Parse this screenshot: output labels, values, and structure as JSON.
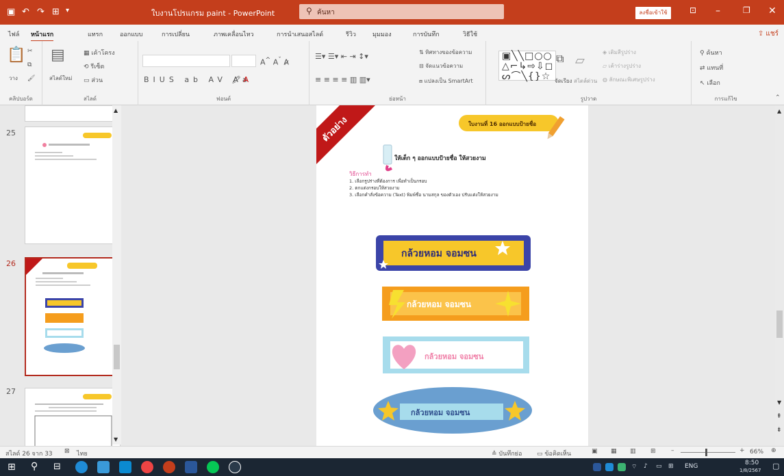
{
  "window": {
    "title": "ใบงานโปรแกรม paint - PowerPoint",
    "search_placeholder": "ค้นหา",
    "signin_label": "ลงชื่อเข้าใช้"
  },
  "tabs": [
    {
      "label": "ไฟล์"
    },
    {
      "label": "หน้าแรก"
    },
    {
      "label": "แทรก"
    },
    {
      "label": "ออกแบบ"
    },
    {
      "label": "การเปลี่ยน"
    },
    {
      "label": "ภาพเคลื่อนไหว"
    },
    {
      "label": "การนำเสนอสไลด์"
    },
    {
      "label": "รีวิว"
    },
    {
      "label": "มุมมอง"
    },
    {
      "label": "การบันทึก"
    },
    {
      "label": "วิธีใช้"
    }
  ],
  "share_label": "แชร์",
  "ribbon": {
    "groups": [
      "คลิปบอร์ด",
      "สไลด์",
      "ฟอนต์",
      "ย่อหน้า",
      "รูปวาด",
      "การแก้ไข"
    ],
    "paste_label": "วาง",
    "new_slide_label": "สไลด์ใหม่",
    "layout_label": "เค้าโครง",
    "reset_label": "รีเซ็ต",
    "section_label": "ส่วน",
    "text_direction_label": "ทิศทางของข้อความ",
    "align_text_label": "จัดแนวข้อความ",
    "smartart_label": "แปลงเป็น SmartArt",
    "arrange_label": "จัดเรียง",
    "quick_styles_label": "สไตล์ด่วน",
    "fill_label": "เติมสีรูปร่าง",
    "outline_label": "เค้าร่างรูปร่าง",
    "effects_label": "ลักษณะพิเศษรูปร่าง",
    "find_label": "ค้นหา",
    "replace_label": "แทนที่",
    "select_label": "เลือก"
  },
  "slides_panel": {
    "numbers": [
      "25",
      "26",
      "27"
    ]
  },
  "slide": {
    "ribbon_label": "ตัวอย่าง",
    "header_badge": "ใบงานที่ 16 ออกแบบป้ายชื่อ",
    "instruction": "ให้เด็ก ๆ ออกแบบป้ายชื่อ ให้สวยงาม",
    "method_title": "วิธีการทำ",
    "steps": [
      "1. เลือกรูปร่างที่ต้องการ เพื่อทำเป็นกรอบ",
      "2. ตกแต่งกรอบให้สวยงาม",
      "3. เลือกคำสั่งข้อความ (Text) พิมพ์ชื่อ นามสกุล ของตัวเอง ปรับแต่งให้สวยงาม"
    ],
    "name_tag_text": "กล้วยหอม จอมซน"
  },
  "status": {
    "slide_position": "สไลด์ 26 จาก 33",
    "language": "ไทย",
    "notes_label": "บันทึกย่อ",
    "comments_label": "ข้อคิดเห็น",
    "zoom": "66%"
  },
  "taskbar": {
    "time": "8:50",
    "date": "1/8/2567",
    "lang": "ENG"
  },
  "colors": {
    "accent": "#c43e1c",
    "tag_yellow": "#f7c72a",
    "tag_blue": "#3b44a8",
    "tag_orange": "#f59d1d",
    "tag_pink": "#f3a0c1",
    "tag_cyan": "#a7dcec",
    "tag_oval": "#6a9fd0"
  }
}
